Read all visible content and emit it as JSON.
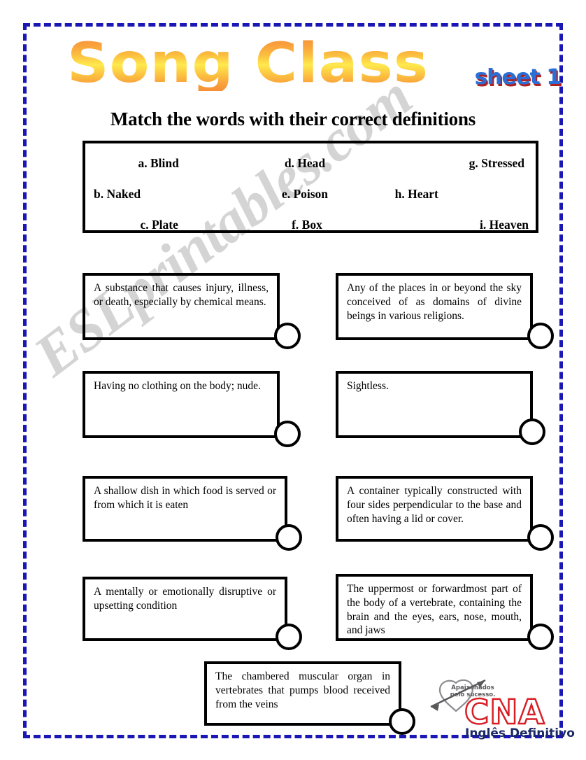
{
  "header": {
    "title": "Song Class",
    "sheet_badge": "sheet 1",
    "instruction": "Match the words with their correct definitions",
    "title_gradient_start": "#f79238",
    "title_gradient_mid": "#ffe94d",
    "badge_color": "#2b6fd6",
    "badge_shadow_color": "#b02020"
  },
  "frame": {
    "border_color": "#1a17b5",
    "style": "dashed"
  },
  "word_bank": {
    "rows": [
      [
        "a. Blind",
        "d. Head",
        "g. Stressed"
      ],
      [
        "b. Naked",
        "e. Poison",
        "h. Heart"
      ],
      [
        "c. Plate",
        "f. Box",
        "i. Heaven"
      ]
    ]
  },
  "definitions": [
    {
      "id": "def-poison",
      "text": "A substance that causes injury, illness, or death, especially by chemical means."
    },
    {
      "id": "def-heaven",
      "text": "Any of the places in or beyond the sky conceived of as domains of divine beings in various religions."
    },
    {
      "id": "def-naked",
      "text": "Having no clothing on the body; nude."
    },
    {
      "id": "def-blind",
      "text": "Sightless."
    },
    {
      "id": "def-plate",
      "text": "A shallow dish in which food is served or from which it is eaten"
    },
    {
      "id": "def-box",
      "text": "A container typically constructed with four sides perpendicular to the base and often having a lid or cover."
    },
    {
      "id": "def-stressed",
      "text": "A mentally or emotionally disruptive or upsetting condition"
    },
    {
      "id": "def-head",
      "text": "The uppermost or forwardmost part of the body of a vertebrate, containing the brain and the eyes, ears, nose, mouth, and jaws"
    },
    {
      "id": "def-heart",
      "text": "The chambered muscular organ in vertebrates that pumps blood received from the veins"
    }
  ],
  "watermark": {
    "text": "ESLprintables.com"
  },
  "logo": {
    "slogan_line1": "Apaixonados",
    "slogan_line2": "pelo sucesso.",
    "brand": "CNA",
    "tagline": "Inglês Definitivo",
    "brand_color": "#d81f26",
    "tagline_color": "#1b2a63"
  }
}
